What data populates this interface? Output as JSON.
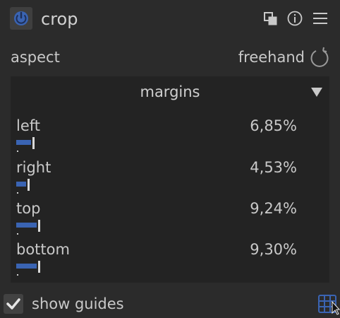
{
  "module": {
    "title": "crop"
  },
  "header_icons": [
    "presets-icon",
    "info-icon",
    "menu-icon"
  ],
  "aspect": {
    "label": "aspect",
    "value": "freehand"
  },
  "margins": {
    "title": "margins",
    "sliders": [
      {
        "label": "left",
        "value": "6,85%",
        "fraction": 0.0685
      },
      {
        "label": "right",
        "value": "4,53%",
        "fraction": 0.0453
      },
      {
        "label": "top",
        "value": "9,24%",
        "fraction": 0.0924
      },
      {
        "label": "bottom",
        "value": "9,30%",
        "fraction": 0.093
      }
    ]
  },
  "guides": {
    "label": "show guides",
    "checked": true
  },
  "colors": {
    "accent": "#3a64b3",
    "background": "#2b2b2b",
    "panel": "#232323"
  }
}
